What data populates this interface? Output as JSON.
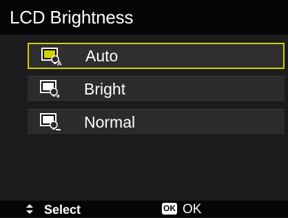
{
  "header": {
    "title": "LCD Brightness"
  },
  "menu": {
    "items": [
      {
        "label": "Auto",
        "icon": "lcd-auto-icon",
        "selected": true
      },
      {
        "label": "Bright",
        "icon": "lcd-bright-icon",
        "selected": false
      },
      {
        "label": "Normal",
        "icon": "lcd-normal-icon",
        "selected": false
      }
    ]
  },
  "footer": {
    "select_label": "Select",
    "ok_badge": "OK",
    "ok_label": "OK"
  },
  "colors": {
    "selection": "#d2d200",
    "icon_fill": "#d2d200",
    "background": "#1c1c1c"
  }
}
